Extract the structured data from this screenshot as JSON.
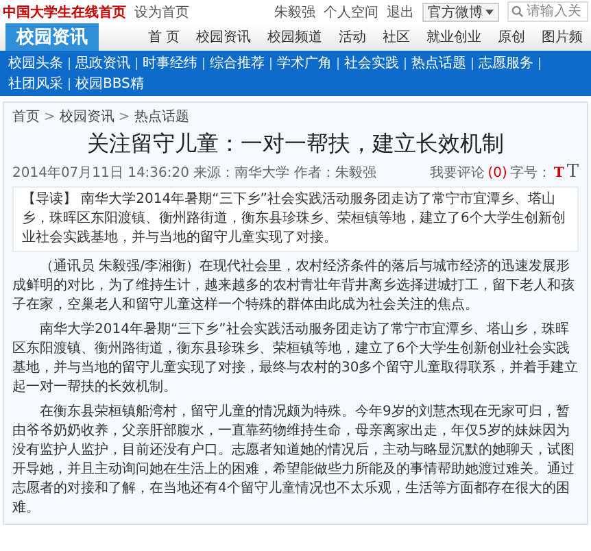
{
  "top_bar": {
    "site_link": "中国大学生在线首页",
    "set_home": "设为首页",
    "user_links": [
      "朱毅强",
      "个人空间",
      "退出"
    ],
    "weibo_dropdown": "官方微博",
    "search": {
      "placeholder": "请输入关"
    }
  },
  "nav": {
    "section_title": "校园资讯",
    "items": [
      "首 页",
      "校园资讯",
      "校园频道",
      "活动",
      "社区",
      "就业创业",
      "原创",
      "图片频"
    ],
    "subnav": [
      "校园头条",
      "思政资讯",
      "时事经纬",
      "综合推荐",
      "学术广角",
      "社会实践",
      "热点话题",
      "志愿服务",
      "社团风采",
      "校园BBS精"
    ]
  },
  "article": {
    "breadcrumb": [
      "首页",
      "校园资讯",
      "热点话题"
    ],
    "breadcrumb_separator": ">",
    "title": "关注留守儿童：一对一帮扶，建立长效机制",
    "meta": {
      "date": "2014年07月11日 14:36:20",
      "source": "来源：南华大学",
      "author": "作者：朱毅强"
    },
    "comment_link": "我要评论",
    "comment_count": "(0)",
    "font_size_label": "字号：",
    "font_sizes": [
      "T",
      "T"
    ],
    "lead": {
      "label": "【导读】",
      "text": "南华大学2014年暑期“三下乡”社会实践活动服务团走访了常宁市宜潭乡、塔山乡，珠晖区东阳渡镇、衡州路街道，衡东县珍珠乡、荣桓镇等地，建立了6个大学生创新创业社会实践基地，并与当地的留守儿童实现了对接。"
    },
    "paragraphs": [
      "（通讯员 朱毅强/李湘衡）在现代社会里，农村经济条件的落后与城市经济的迅速发展形成鲜明的对比，为了维持生计，越来越多的农村青壮年背井离乡选择进城打工，留下老人和孩子在家，空巢老人和留守儿童这样一个特殊的群体由此成为社会关注的焦点。",
      "南华大学2014年暑期“三下乡”社会实践活动服务团走访了常宁市宜潭乡、塔山乡，珠晖区东阳渡镇、衡州路街道，衡东县珍珠乡、荣桓镇等地，建立了6个大学生创新创业社会实践基地，并与当地的留守儿童实现了对接，最终与农村的30多个留守儿童取得联系，并着手建立起一对一帮扶的长效机制。",
      "在衡东县荣桓镇船湾村，留守儿童的情况颇为特殊。今年9岁的刘慧杰现在无家可归，暂由爷爷奶奶收养，父亲肝部腹水，一直靠药物维持生命，母亲离家出走，年仅5岁的妹妹因为没有监护人监护，目前还没有户口。志愿者知道她的情况后，主动与略显沉默的她聊天，试图开导她，并且主动询问她在生活上的困难，希望能做些力所能及的事情帮助她渡过难关。通过志愿者的对接和了解，在当地还有4个留守儿童情况也不太乐观，生活等方面都存在很大的困难。"
    ]
  }
}
